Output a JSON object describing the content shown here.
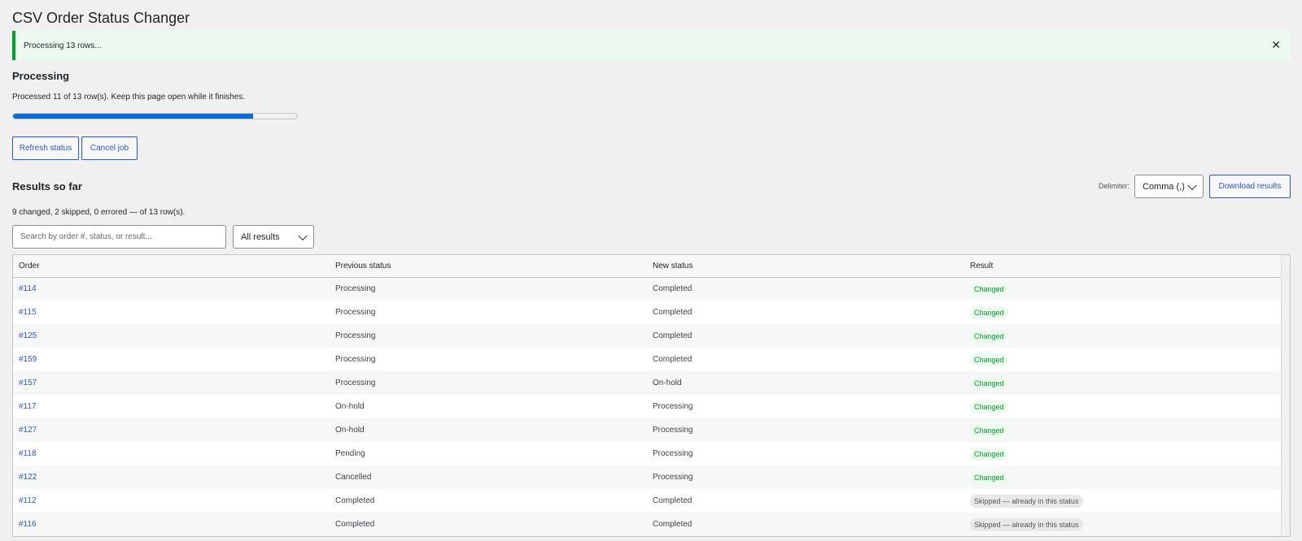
{
  "page": {
    "title": "CSV Order Status Changer"
  },
  "notice": {
    "text": "Processing 13 rows...",
    "dismiss_glyph": "✕"
  },
  "processing": {
    "title": "Processing",
    "text": "Processed 11 of 13 row(s). Keep this page open while it finishes.",
    "progress": 0.846,
    "refresh_label": "Refresh status",
    "cancel_label": "Cancel job"
  },
  "results": {
    "title": "Results so far",
    "delimiter_label": "Delimiter:",
    "delimiter_value": "Comma (,)",
    "download_label": "Download results",
    "summary": "9 changed, 2 skipped, 0 errored — of 13 row(s).",
    "search_placeholder": "Search by order #, status, or result...",
    "filter_value": "All results",
    "columns": [
      "Order",
      "Previous status",
      "New status",
      "Result"
    ],
    "rows": [
      {
        "order": "#114",
        "prev": "Processing",
        "new": "Completed",
        "result": "Changed",
        "kind": "changed"
      },
      {
        "order": "#115",
        "prev": "Processing",
        "new": "Completed",
        "result": "Changed",
        "kind": "changed"
      },
      {
        "order": "#125",
        "prev": "Processing",
        "new": "Completed",
        "result": "Changed",
        "kind": "changed"
      },
      {
        "order": "#159",
        "prev": "Processing",
        "new": "Completed",
        "result": "Changed",
        "kind": "changed"
      },
      {
        "order": "#157",
        "prev": "Processing",
        "new": "On-hold",
        "result": "Changed",
        "kind": "changed"
      },
      {
        "order": "#117",
        "prev": "On-hold",
        "new": "Processing",
        "result": "Changed",
        "kind": "changed"
      },
      {
        "order": "#127",
        "prev": "On-hold",
        "new": "Processing",
        "result": "Changed",
        "kind": "changed"
      },
      {
        "order": "#118",
        "prev": "Pending",
        "new": "Processing",
        "result": "Changed",
        "kind": "changed"
      },
      {
        "order": "#122",
        "prev": "Cancelled",
        "new": "Processing",
        "result": "Changed",
        "kind": "changed"
      },
      {
        "order": "#112",
        "prev": "Completed",
        "new": "Completed",
        "result": "Skipped — already in this status",
        "kind": "skipped"
      },
      {
        "order": "#116",
        "prev": "Completed",
        "new": "Completed",
        "result": "Skipped — already in this status",
        "kind": "skipped"
      }
    ]
  },
  "colors": {
    "accent": "#2f55d4",
    "progress": "#0a6ad6",
    "success": "#00a32a"
  }
}
